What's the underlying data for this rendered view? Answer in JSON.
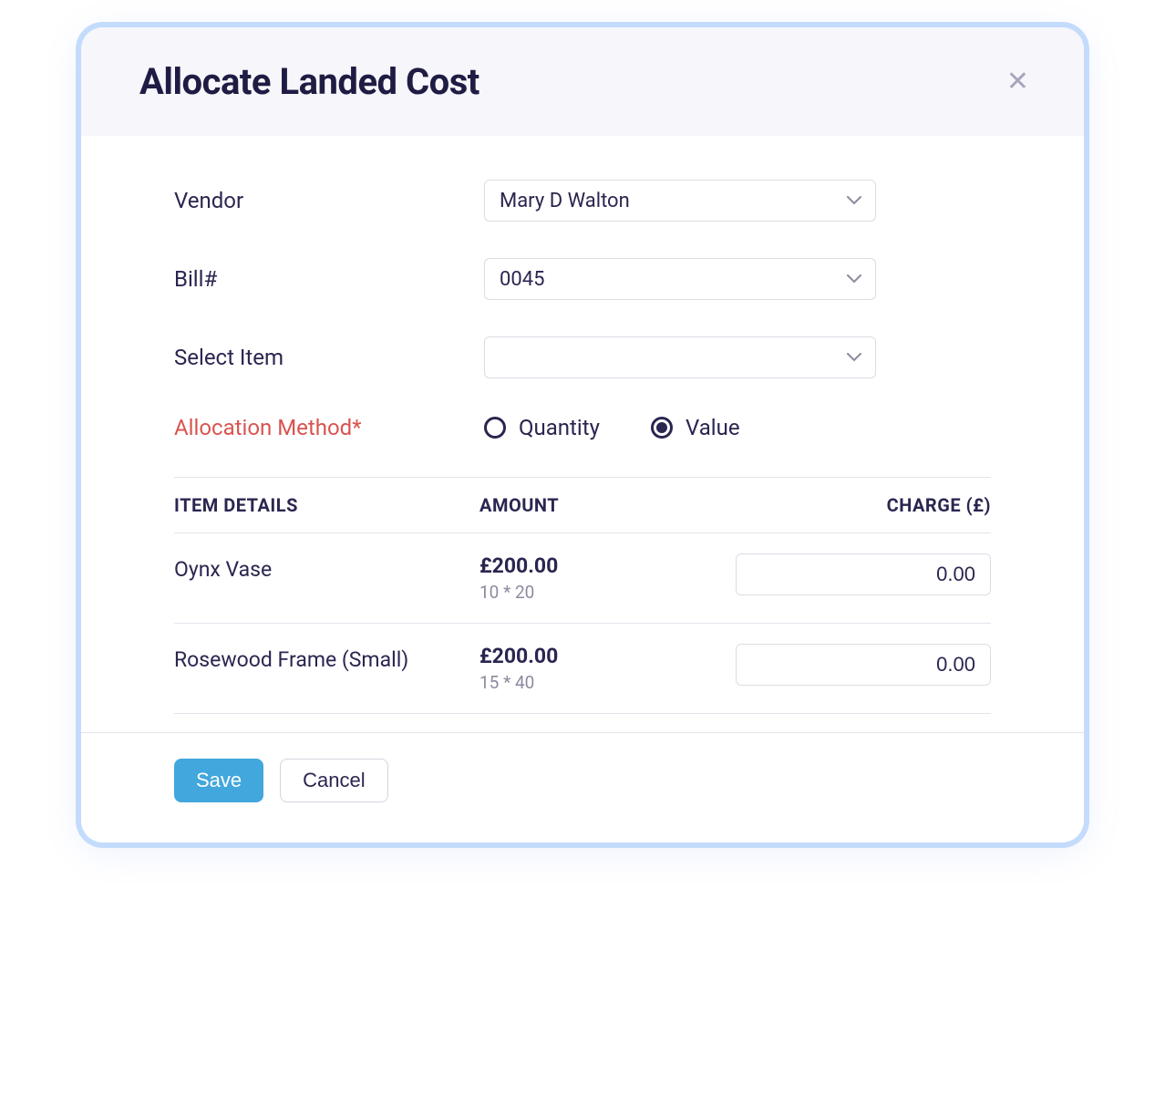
{
  "modal": {
    "title": "Allocate Landed Cost"
  },
  "form": {
    "vendor_label": "Vendor",
    "vendor_value": "Mary D Walton",
    "bill_label": "Bill#",
    "bill_value": "0045",
    "select_item_label": "Select Item",
    "select_item_value": "",
    "allocation_method_label": "Allocation  Method*",
    "radio_quantity": "Quantity",
    "radio_value": "Value",
    "selected_method": "value"
  },
  "table": {
    "headers": {
      "details": "ITEM DETAILS",
      "amount": "AMOUNT",
      "charge": "CHARGE (£)"
    },
    "rows": [
      {
        "name": "Oynx Vase",
        "amount": "£200.00",
        "calc": "10 * 20",
        "charge": "0.00"
      },
      {
        "name": "Rosewood Frame (Small)",
        "amount": "£200.00",
        "calc": "15 * 40",
        "charge": "0.00"
      }
    ]
  },
  "footer": {
    "save": "Save",
    "cancel": "Cancel"
  }
}
